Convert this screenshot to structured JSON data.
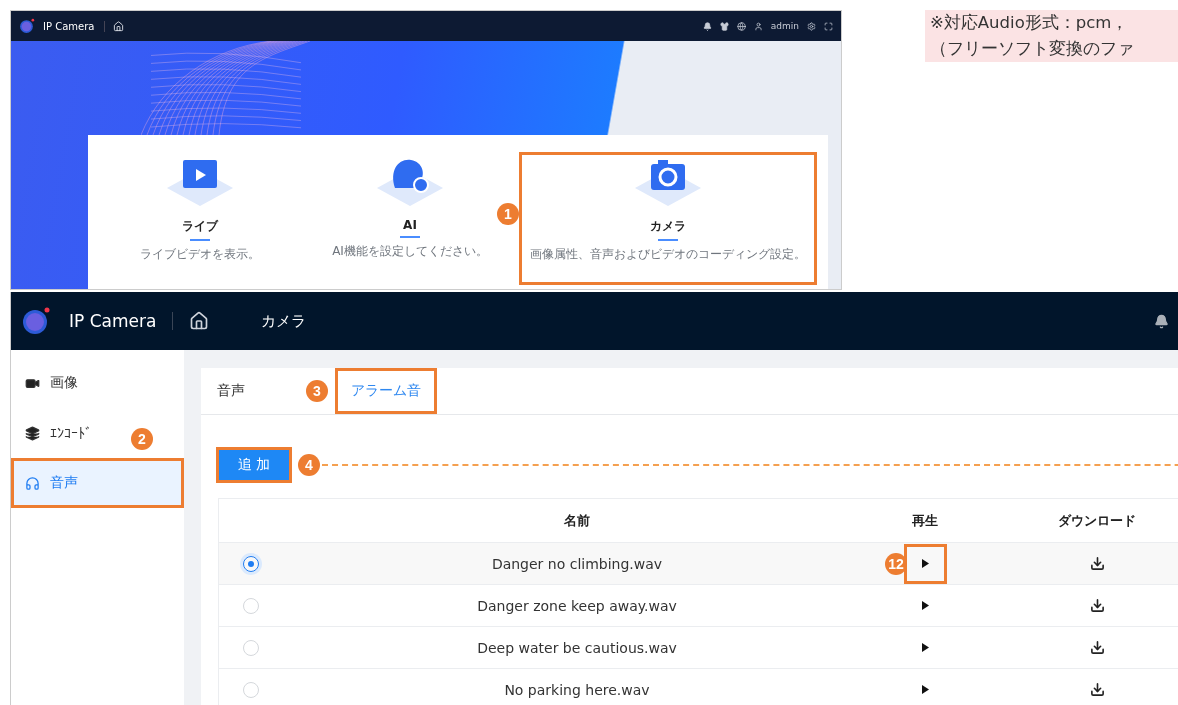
{
  "overview_screen": {
    "app_title": "IP Camera",
    "user": "admin",
    "modules": [
      {
        "kind": "live",
        "title": "ライブ",
        "description": "ライブビデオを表示。",
        "highlighted": false
      },
      {
        "kind": "ai",
        "title": "AI",
        "description": "AI機能を設定してください。",
        "highlighted": false
      },
      {
        "kind": "camera",
        "title": "カメラ",
        "description": "画像属性、音声およびビデオのコーディング設定。",
        "highlighted": true,
        "marker": "1"
      }
    ]
  },
  "note": {
    "lines": [
      "※対応Audio形式：pcm，",
      "（フリーソフト変換のファ"
    ]
  },
  "settings_screen": {
    "app_title": "IP Camera",
    "breadcrumb": "カメラ",
    "sidebar": {
      "items": [
        {
          "kind": "image",
          "label": "画像",
          "selected": false,
          "highlighted": false
        },
        {
          "kind": "encode",
          "label": "ｴﾝｺｰﾄﾞ",
          "selected": false,
          "highlighted": false
        },
        {
          "kind": "audio",
          "label": "音声",
          "selected": true,
          "highlighted": true,
          "marker": "2"
        }
      ]
    },
    "tabs": [
      {
        "label": "音声",
        "selected": false,
        "highlighted": false
      },
      {
        "label": "アラーム音",
        "selected": true,
        "highlighted": true,
        "marker": "3"
      }
    ],
    "add_button": {
      "label": "追 加",
      "highlighted": true,
      "marker": "4"
    },
    "table": {
      "columns": [
        "名前",
        "再生",
        "ダウンロード"
      ],
      "rows": [
        {
          "name": "Danger no climbing.wav",
          "selected": true,
          "play_highlighted": true,
          "play_marker": "12"
        },
        {
          "name": "Danger zone keep away.wav",
          "selected": false,
          "play_highlighted": false
        },
        {
          "name": "Deep water be cautious.wav",
          "selected": false,
          "play_highlighted": false
        },
        {
          "name": "No parking here.wav",
          "selected": false,
          "play_highlighted": false
        }
      ]
    }
  }
}
